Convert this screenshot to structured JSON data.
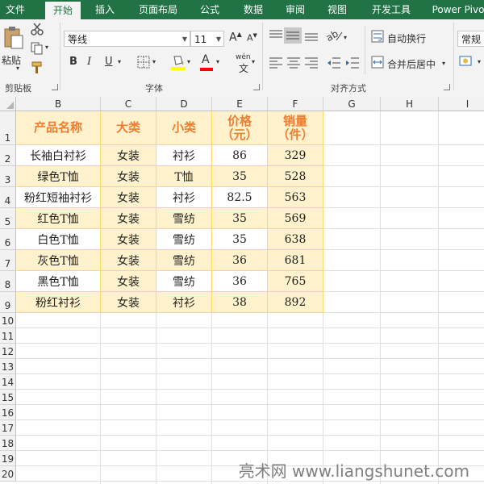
{
  "ribbon_tabs": [
    "文件",
    "开始",
    "插入",
    "页面布局",
    "公式",
    "数据",
    "审阅",
    "视图",
    "开发工具",
    "Power Pivo"
  ],
  "clipboard": {
    "paste": "粘贴",
    "label": "剪贴板"
  },
  "font": {
    "name": "等线",
    "size": "11",
    "label": "字体",
    "bold": "B",
    "italic": "I",
    "underline": "U",
    "grow": "A",
    "shrink": "A",
    "fill_label": "A",
    "phonetic": "wén",
    "color": "A"
  },
  "align": {
    "wrap": "自动换行",
    "merge": "合并后居中",
    "label": "对齐方式"
  },
  "number": {
    "format": "常规"
  },
  "columns": [
    "B",
    "C",
    "D",
    "E",
    "F",
    "G",
    "H",
    "I"
  ],
  "rows": [
    "1",
    "2",
    "3",
    "4",
    "5",
    "6",
    "7",
    "8",
    "9",
    "10",
    "11",
    "12",
    "13",
    "14",
    "15",
    "16",
    "17",
    "18",
    "19",
    "20"
  ],
  "table": {
    "headers": [
      [
        "产品名称"
      ],
      [
        "大类"
      ],
      [
        "小类"
      ],
      [
        "价格",
        "（元）"
      ],
      [
        "销量",
        "（件）"
      ]
    ],
    "data": [
      [
        "长袖白衬衫",
        "女装",
        "衬衫",
        "86",
        "329"
      ],
      [
        "绿色T恤",
        "女装",
        "T恤",
        "35",
        "528"
      ],
      [
        "粉红短袖衬衫",
        "女装",
        "衬衫",
        "82.5",
        "563"
      ],
      [
        "红色T恤",
        "女装",
        "雪纺",
        "35",
        "569"
      ],
      [
        "白色T恤",
        "女装",
        "雪纺",
        "35",
        "638"
      ],
      [
        "灰色T恤",
        "女装",
        "雪纺",
        "36",
        "681"
      ],
      [
        "黑色T恤",
        "女装",
        "雪纺",
        "36",
        "765"
      ],
      [
        "粉红衬衫",
        "女装",
        "衬衫",
        "38",
        "892"
      ]
    ]
  },
  "watermark": "亮术网 www.liangshunet.com",
  "colors": {
    "accent": "#217346",
    "header_text": "#ed7d31",
    "band": "#fff2cc",
    "border": "#ffd966"
  }
}
